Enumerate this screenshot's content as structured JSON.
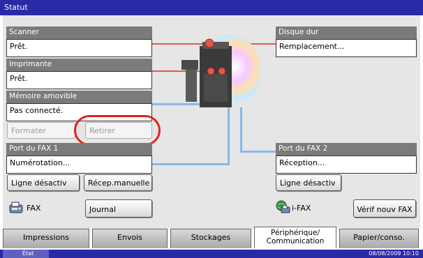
{
  "title": "Statut",
  "scanner": {
    "label": "Scanner",
    "value": "Prêt."
  },
  "printer": {
    "label": "Imprimante",
    "value": "Prêt."
  },
  "disk": {
    "label": "Disque dur",
    "value": "Remplacement..."
  },
  "removable": {
    "label": "Mémoire amovible",
    "value": "Pas connecté.",
    "format_label": "Formater",
    "remove_label": "Retirer"
  },
  "fax1": {
    "label": "Port du FAX 1",
    "value": "Numérotation...",
    "line_off_label": "Ligne désactiv",
    "manual_recv_label": "Récep.manuelle"
  },
  "fax2": {
    "label": "Port du FAX 2",
    "value": "Réception...",
    "line_off_label": "Ligne désactiv"
  },
  "fax": {
    "label": "FAX",
    "journal_label": "Journal"
  },
  "ifax": {
    "label": "i-FAX",
    "verify_label": "Vérif nouv FAX"
  },
  "tabs": [
    {
      "label": "Impressions"
    },
    {
      "label": "Envois"
    },
    {
      "label": "Stockages"
    },
    {
      "label_line1": "Périphérique/",
      "label_line2": "Communication"
    },
    {
      "label": "Papier/conso."
    }
  ],
  "status": {
    "label": "État",
    "datetime": "08/08/2009   10:10"
  },
  "colors": {
    "title_bar": "#2a2aa6",
    "panel_head": "#7b7b7b",
    "highlight": "#e2231a",
    "connector": "#8ab8e8"
  }
}
